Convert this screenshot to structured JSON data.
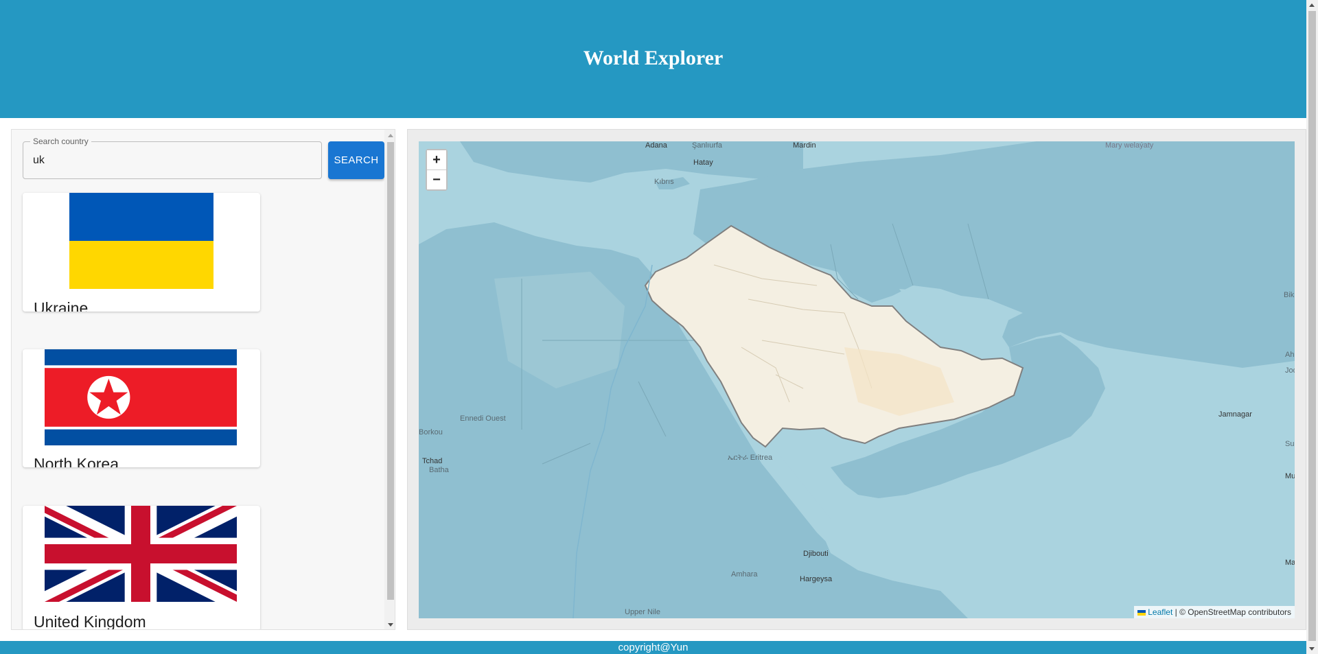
{
  "header": {
    "title": "World Explorer"
  },
  "search": {
    "label": "Search country",
    "value": "uk",
    "button_label": "SEARCH"
  },
  "results": [
    {
      "name": "Ukraine",
      "flag": "ukraine-flag"
    },
    {
      "name": "North Korea",
      "flag": "north-korea-flag"
    },
    {
      "name": "United Kingdom",
      "flag": "united-kingdom-flag"
    }
  ],
  "map": {
    "zoom_in": "+",
    "zoom_out": "−",
    "attribution_link": "Leaflet",
    "attribution_rest": " | © OpenStreetMap contributors",
    "labels": {
      "adana": "Adana",
      "mardin": "Mardin",
      "hatay": "Hatay",
      "kibris": "Kıbrıs",
      "eritrea": "ኤርትራ Eritrea",
      "djibouti": "Djibouti",
      "hargeysa": "Hargeysa",
      "tchad": "Tchad",
      "batha": "Batha",
      "borkou": "Borkou",
      "ennedi": "Ennedi Ouest",
      "mary": "Mary welaýaty",
      "jamnagar": "Jamnagar",
      "ahmeda": "Ahmeda",
      "sanliurfa": "Şanlıurfa",
      "upper_nile": "Upper Nile",
      "amhara": "Amhara",
      "bik": "Bik",
      "jodh": "Jodh",
      "sur": "Sur",
      "muri": "Muri",
      "man": "Man"
    }
  },
  "colors": {
    "header": "#2598c2",
    "button": "#1976d2",
    "highlight_country": "#f4efe2",
    "sea": "#aad3df"
  },
  "footer": {
    "text": "copyright@Yun"
  }
}
